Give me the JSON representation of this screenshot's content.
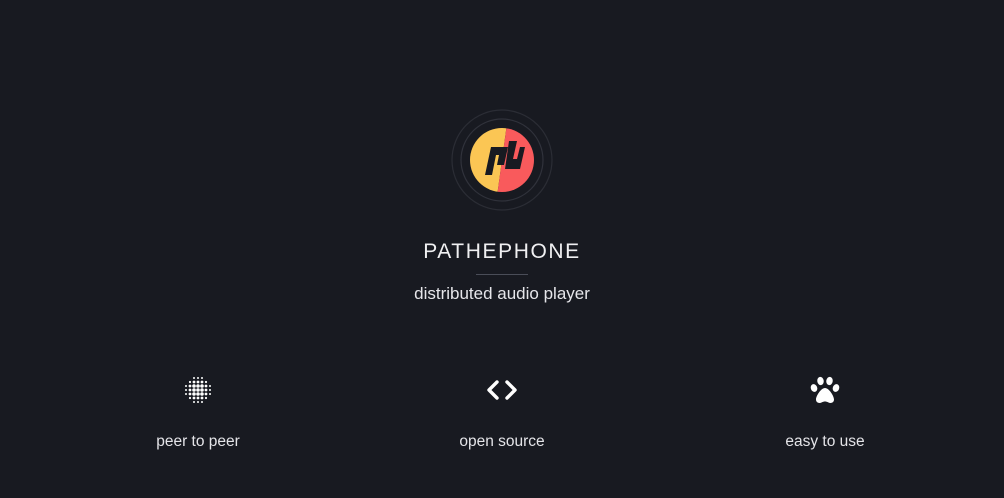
{
  "app": {
    "title": "PATHEPHONE",
    "tagline": "distributed audio player"
  },
  "logo": {
    "icon": "pathephone-logo-icon",
    "colors": {
      "yellow": "#fbc654",
      "red": "#f95a5c",
      "ring": "#2e3038"
    }
  },
  "features": [
    {
      "icon": "dot-sphere-icon",
      "label": "peer to peer"
    },
    {
      "icon": "code-brackets-icon",
      "label": "open source"
    },
    {
      "icon": "paw-icon",
      "label": "easy to use"
    }
  ],
  "theme": {
    "background": "#181a21",
    "text": "#f0f0f2"
  }
}
